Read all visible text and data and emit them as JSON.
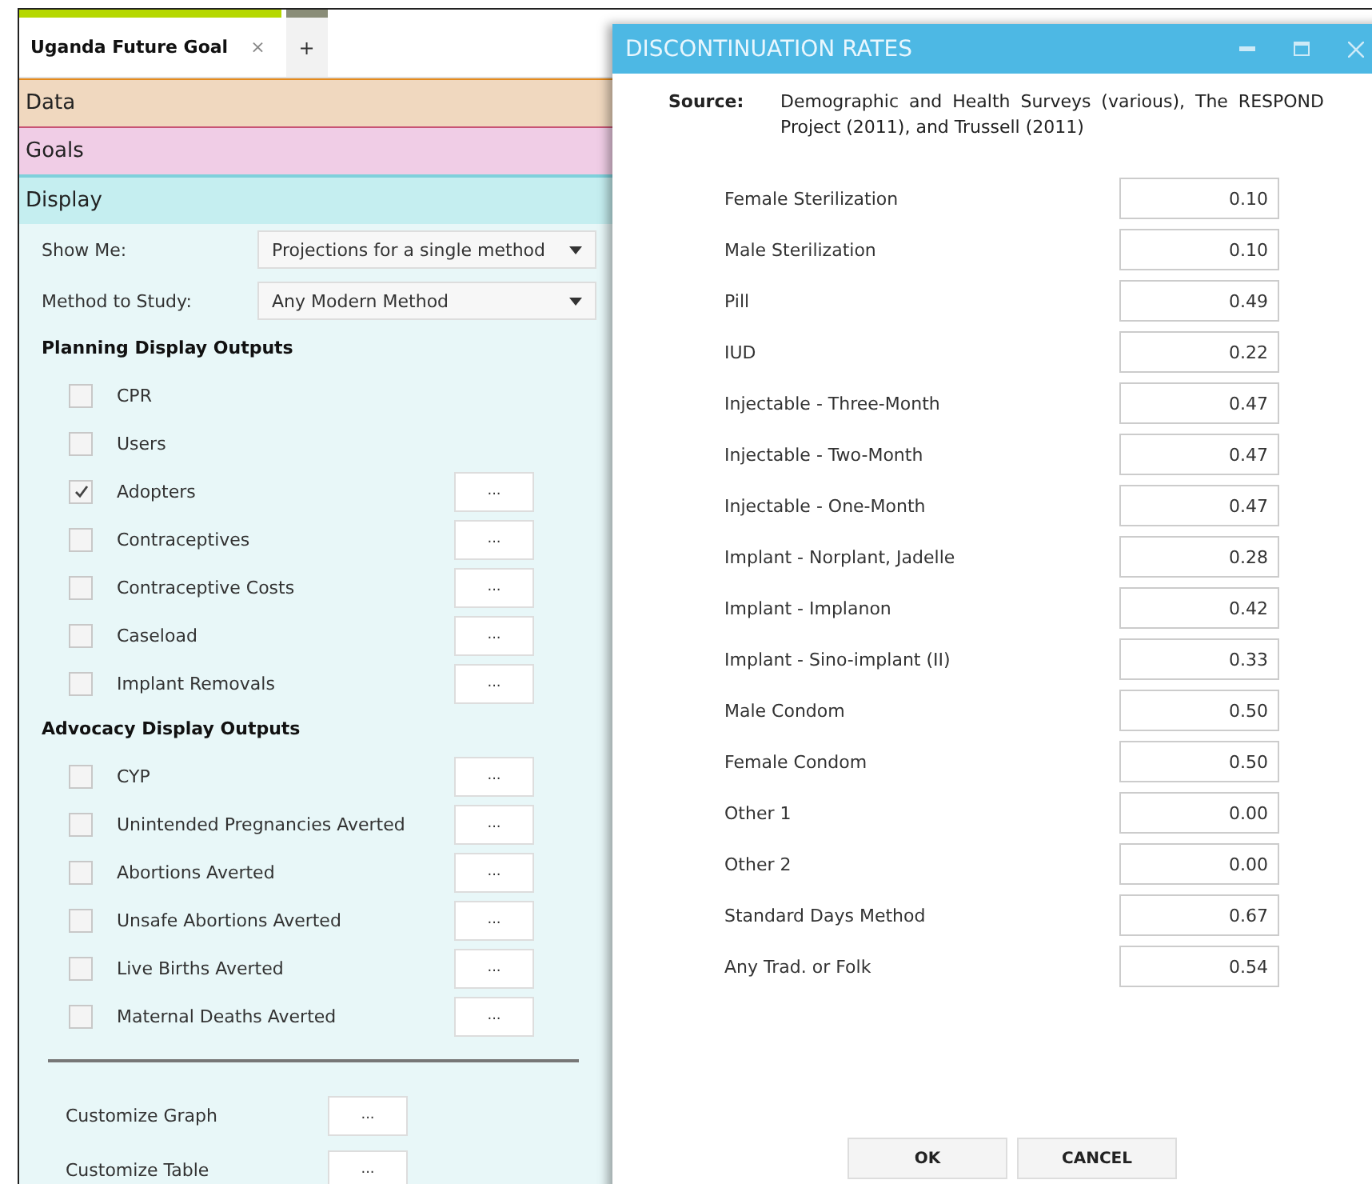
{
  "tabs": [
    {
      "label": "Uganda Future Goal",
      "close": "×",
      "selected": true
    },
    {
      "label": "+",
      "selected": false
    }
  ],
  "sections": [
    {
      "title": "Data",
      "kind": "data"
    },
    {
      "title": "Goals",
      "kind": "goals"
    },
    {
      "title": "Display",
      "kind": "display"
    }
  ],
  "display": {
    "fields": [
      {
        "label": "Show Me:",
        "value": "Projections for a single method"
      },
      {
        "label": "Method to Study:",
        "value": "Any Modern Method"
      }
    ],
    "groups": [
      {
        "heading": "Planning Display Outputs",
        "items": [
          {
            "label": "CPR",
            "checked": false
          },
          {
            "label": "Users",
            "checked": false
          },
          {
            "label": "Adopters",
            "checked": true,
            "button": "..."
          },
          {
            "label": "Contraceptives",
            "checked": false,
            "button": "..."
          },
          {
            "label": "Contraceptive Costs",
            "checked": false,
            "button": "..."
          },
          {
            "label": "Caseload",
            "checked": false,
            "button": "..."
          },
          {
            "label": "Implant Removals",
            "checked": false,
            "button": "..."
          }
        ]
      },
      {
        "heading": "Advocacy Display Outputs",
        "items": [
          {
            "label": "CYP",
            "checked": false,
            "button": "..."
          },
          {
            "label": "Unintended Pregnancies Averted",
            "checked": false,
            "button": "..."
          },
          {
            "label": "Abortions Averted",
            "checked": false,
            "button": "..."
          },
          {
            "label": "Unsafe Abortions Averted",
            "checked": false,
            "button": "..."
          },
          {
            "label": "Live Births Averted",
            "checked": false,
            "button": "..."
          },
          {
            "label": "Maternal Deaths Averted",
            "checked": false,
            "button": "..."
          }
        ]
      }
    ],
    "customize": [
      {
        "label": "Customize Graph",
        "button": "..."
      },
      {
        "label": "Customize Table",
        "button": "..."
      }
    ]
  },
  "dialog": {
    "title": "DISCONTINUATION RATES",
    "source_label": "Source:",
    "source": "Demographic and Health Surveys (various), The RESPOND Project (2011), and Trussell (2011)",
    "rates": [
      {
        "label": "Female Sterilization",
        "value": "0.10"
      },
      {
        "label": "Male Sterilization",
        "value": "0.10"
      },
      {
        "label": "Pill",
        "value": "0.49"
      },
      {
        "label": "IUD",
        "value": "0.22"
      },
      {
        "label": "Injectable - Three-Month",
        "value": "0.47"
      },
      {
        "label": "Injectable - Two-Month",
        "value": "0.47"
      },
      {
        "label": "Injectable - One-Month",
        "value": "0.47"
      },
      {
        "label": "Implant - Norplant, Jadelle",
        "value": "0.28"
      },
      {
        "label": "Implant - Implanon",
        "value": "0.42"
      },
      {
        "label": "Implant - Sino-implant (II)",
        "value": "0.33"
      },
      {
        "label": "Male Condom",
        "value": "0.50"
      },
      {
        "label": "Female Condom",
        "value": "0.50"
      },
      {
        "label": "Other 1",
        "value": "0.00"
      },
      {
        "label": "Other 2",
        "value": "0.00"
      },
      {
        "label": "Standard Days Method",
        "value": "0.67"
      },
      {
        "label": "Any Trad. or Folk",
        "value": "0.54"
      }
    ],
    "buttons": [
      "OK",
      "CANCEL"
    ]
  }
}
